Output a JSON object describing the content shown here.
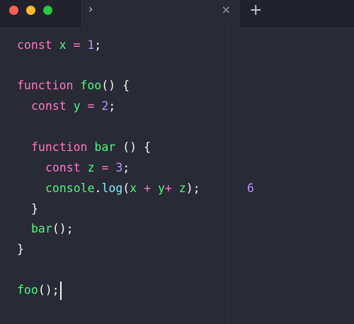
{
  "tabbar": {
    "chevron": "›",
    "close": "×",
    "new_tab": "+"
  },
  "code": {
    "l1": {
      "kw": "const",
      "name": "x",
      "op": "=",
      "num": "1",
      "end": ";"
    },
    "l3": {
      "kw": "function",
      "name": "foo",
      "rest": "() {"
    },
    "l4": {
      "kw": "const",
      "name": "y",
      "op": "=",
      "num": "2",
      "end": ";"
    },
    "l6": {
      "kw": "function",
      "name": "bar",
      "rest": " () {"
    },
    "l7": {
      "kw": "const",
      "name": "z",
      "op": "=",
      "num": "3",
      "end": ";"
    },
    "l8": {
      "obj": "console",
      "dot": ".",
      "method": "log",
      "open": "(",
      "a": "x",
      "plus1": "+",
      "b": "y",
      "plus2": "+",
      "c": "z",
      "close": ");"
    },
    "l9": {
      "text": "}"
    },
    "l10": {
      "name": "bar",
      "rest": "();"
    },
    "l11": {
      "text": "}"
    },
    "l13": {
      "name": "foo",
      "rest": "();"
    }
  },
  "results": {
    "r8": "6"
  },
  "colors": {
    "background": "#282a36",
    "keyword": "#ff79c6",
    "function": "#50fa7b",
    "number": "#bd93f9",
    "property": "#8be9fd"
  }
}
